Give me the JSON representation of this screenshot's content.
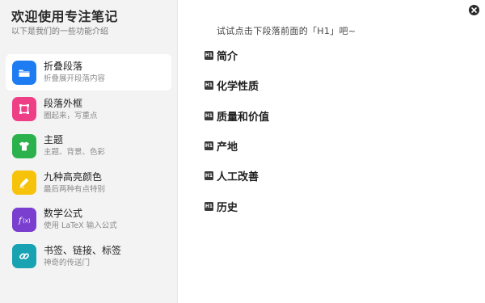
{
  "sidebar": {
    "title": "欢迎使用专注笔记",
    "subtitle": "以下是我们的一些功能介绍",
    "items": [
      {
        "title": "折叠段落",
        "desc": "折叠展开段落内容",
        "icon": "folder-icon",
        "color": "#1e7cf2"
      },
      {
        "title": "段落外框",
        "desc": "圈起来，写重点",
        "icon": "frame-icon",
        "color": "#ee3f86"
      },
      {
        "title": "主题",
        "desc": "主题、背景、色彩",
        "icon": "tshirt-icon",
        "color": "#2bb24c"
      },
      {
        "title": "九种高亮颜色",
        "desc": "最后两种有点特别",
        "icon": "highlighter-icon",
        "color": "#f7c20a"
      },
      {
        "title": "数学公式",
        "desc": "使用 LaTeX 输入公式",
        "icon": "function-icon",
        "color": "#7a3fcf"
      },
      {
        "title": "书签、链接、标签",
        "desc": "神奇的传送门",
        "icon": "link-icon",
        "color": "#19a3b2"
      }
    ]
  },
  "main": {
    "hint": "试试点击下段落前面的「H1」吧~",
    "badge": "H1",
    "headings": [
      "简介",
      "化学性质",
      "质量和价值",
      "产地",
      "人工改善",
      "历史"
    ]
  },
  "close": {
    "icon": "close-icon"
  }
}
